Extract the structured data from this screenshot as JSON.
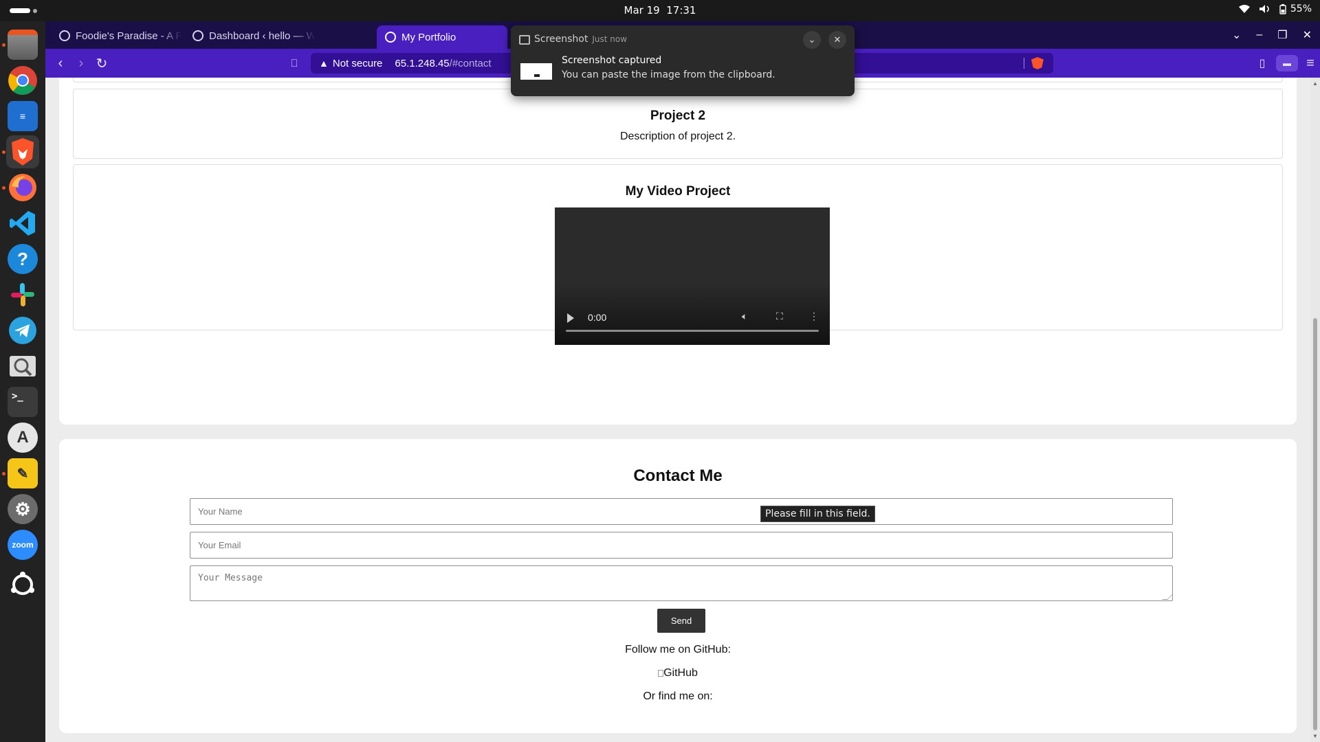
{
  "system": {
    "date": "Mar 19",
    "time": "17:31",
    "battery": "55%"
  },
  "dock": {
    "apps": [
      "files",
      "chrome",
      "libreoffice-writer",
      "brave",
      "firefox",
      "vscode",
      "help",
      "slack",
      "telegram",
      "image-viewer",
      "terminal",
      "software-center",
      "text-editor",
      "settings",
      "zoom",
      "ubuntu"
    ],
    "zoom_label": "zoom"
  },
  "browser": {
    "tabs": [
      {
        "label": "Foodie's Paradise - A Food B",
        "active": false
      },
      {
        "label": "Dashboard ‹ hello — WordP",
        "active": false
      },
      {
        "label": "My Portfolio",
        "active": true
      }
    ],
    "security_label": "Not secure",
    "url_host": "65.1.248.45",
    "url_path": "/#contact",
    "accent_color": "#4a1fc0",
    "tabbar_color": "#1b0f47"
  },
  "notification": {
    "app_name": "Screenshot",
    "time": "Just now",
    "title": "Screenshot captured",
    "body": "You can paste the image from the clipboard."
  },
  "projects": {
    "project2": {
      "title": "Project 2",
      "description": "Description of project 2."
    },
    "video_project": {
      "title": "My Video Project",
      "current_time": "0:00"
    }
  },
  "contact": {
    "title": "Contact Me",
    "name_placeholder": "Your Name",
    "email_placeholder": "Your Email",
    "message_placeholder": "Your Message",
    "send_label": "Send",
    "validation_tooltip": "Please fill in this field.",
    "follow_text": "Follow me on GitHub:",
    "github_alt": "GitHub",
    "find_text": "Or find me on:"
  }
}
